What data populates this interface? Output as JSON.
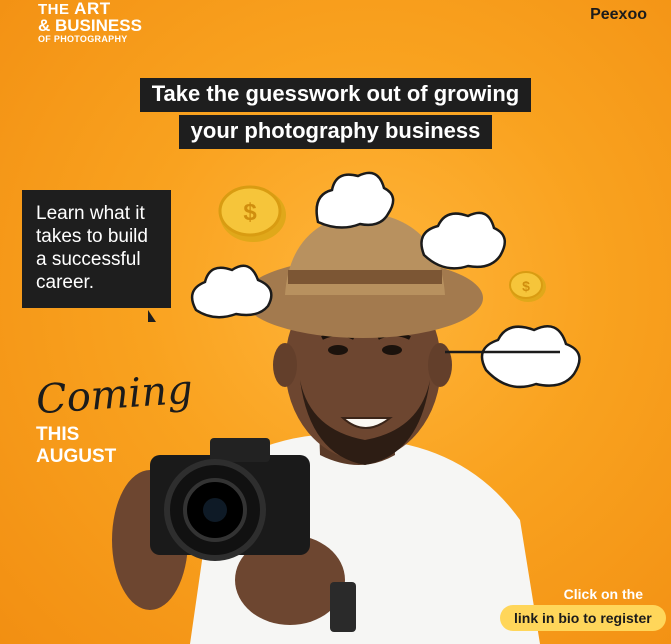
{
  "brand": {
    "line1a": "THE ",
    "line1b": "ART",
    "line2": "& BUSINESS",
    "line3": "OF PHOTOGRAPHY"
  },
  "logo": {
    "text": "Peexoo"
  },
  "headline": {
    "line1": "Take the guesswork out of growing",
    "line2": "your photography business"
  },
  "learn": {
    "text": "Learn what it takes to build a successful career."
  },
  "coming": {
    "script": "Coming",
    "line1": "THIS",
    "line2": "AUGUST"
  },
  "cta": {
    "line1": "Click on the",
    "line2": "link in bio to register"
  },
  "icons": [
    "coin-icon",
    "cloud-icon",
    "camera-icon"
  ],
  "colors": {
    "background": "#f9a21f",
    "dark": "#1e1e1e",
    "accent": "#ffd65a"
  }
}
